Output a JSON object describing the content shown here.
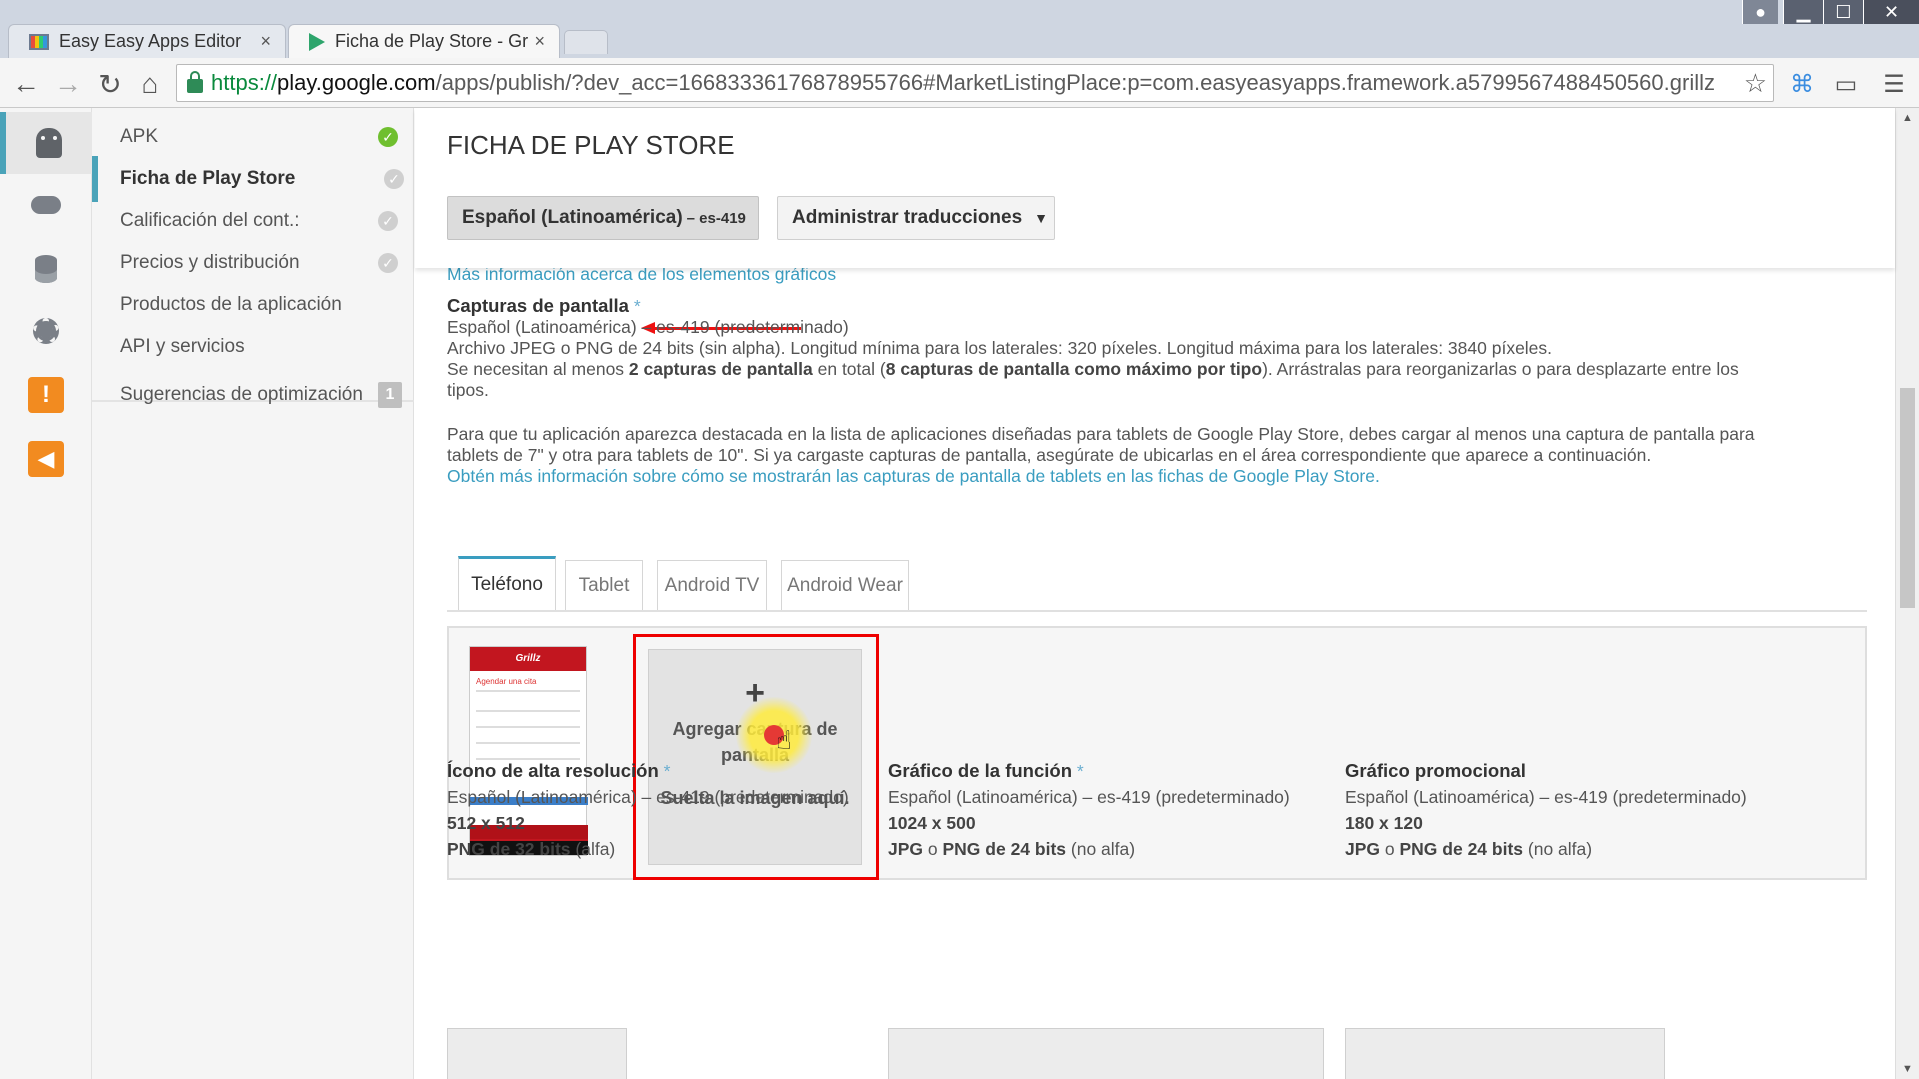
{
  "browser": {
    "tabs": [
      {
        "title": "Easy Easy Apps Editor",
        "icon": "editor-favicon",
        "active": false
      },
      {
        "title": "Ficha de Play Store - Grillz",
        "icon": "play-store-favicon",
        "active": true
      }
    ],
    "close_glyph": "×",
    "url": {
      "protocol": "https://",
      "host": "play.google.com",
      "path": "/apps/publish/?dev_acc=16683336176878955766#MarketListingPlace:p=com.easyeasyapps.framework.a5799567488450560.grillz"
    }
  },
  "rail": [
    "android-icon",
    "gamepad-icon",
    "database-icon",
    "gear-icon",
    "warning-icon",
    "megaphone-icon"
  ],
  "nav": {
    "items": [
      {
        "label": "APK",
        "status": "complete"
      },
      {
        "label": "Ficha de Play Store",
        "status": "pending",
        "active": true
      },
      {
        "label": "Calificación del cont.:",
        "status": "pending"
      },
      {
        "label": "Precios y distribución",
        "status": "pending"
      },
      {
        "label": "Productos de la aplicación"
      },
      {
        "label": "API y servicios"
      }
    ],
    "optimization": {
      "label": "Sugerencias de optimización",
      "count": "1"
    }
  },
  "header": {
    "title": "FICHA DE PLAY STORE",
    "language_button": "Español (Latinoamérica)",
    "language_code": "– es-419",
    "translations_button": "Administrar traducciones",
    "caret": "▼"
  },
  "graphics": {
    "more_info_link": "Más información acerca de los elementos gráficos"
  },
  "screenshots": {
    "title": "Capturas de pantalla",
    "required_mark": "*",
    "language": "Español (Latinoamérica) – es-419 (predeterminado)",
    "format": "Archivo JPEG o PNG de 24 bits (sin alpha). Longitud mínima para los laterales: 320 píxeles. Longitud máxima para los laterales: 3840 píxeles.",
    "need_prefix": "Se necesitan al menos ",
    "need_bold1": "2 capturas de pantalla",
    "need_mid": " en total (",
    "need_bold2": "8 capturas de pantalla como máximo por tipo",
    "need_suffix": "). Arrástralas para reorganizarlas o para desplazarte entre los",
    "need_cont": "tipos.",
    "tablet_info_1": "Para que tu aplicación aparezca destacada en la lista de aplicaciones diseñadas para tablets de Google Play Store, debes cargar al menos una captura de pantalla para",
    "tablet_info_2": "tablets de 7\" y otra para tablets de 10\". Si ya cargaste capturas de pantalla, asegúrate de ubicarlas en el área correspondiente que aparece a continuación.",
    "tablet_link": "Obtén más información sobre cómo se mostrarán las capturas de pantalla de tablets en las fichas de Google Play Store.",
    "tabs": [
      "Teléfono",
      "Tablet",
      "Android TV",
      "Android Wear"
    ],
    "phone_brand": "Grillz",
    "phone_heading": "Agendar una cita",
    "add_plus": "+",
    "add_label": "Agregar captura de pantalla",
    "drop_label": "Suelta la imagen aquí."
  },
  "assets": [
    {
      "title": "Ícono de alta resolución",
      "required": "*",
      "language": "Español (Latinoamérica) – es-419 (predeterminado)",
      "size": "512 x 512",
      "format_bold": "PNG de 32 bits",
      "format_rest": " (alfa)"
    },
    {
      "title": "Gráfico de la función",
      "required": "*",
      "language": "Español (Latinoamérica) – es-419 (predeterminado)",
      "size": "1024 x 500",
      "format_bold_1": "JPG",
      "format_mid": " o ",
      "format_bold": "PNG de 24 bits",
      "format_rest": " (no alfa)"
    },
    {
      "title": "Gráfico promocional",
      "required": "",
      "language": "Español (Latinoamérica) – es-419 (predeterminado)",
      "size": "180 x 120",
      "format_bold_1": "JPG",
      "format_mid": " o ",
      "format_bold": "PNG de 24 bits",
      "format_rest": " (no alfa)"
    }
  ],
  "colors": {
    "accent": "#3a9dc0",
    "highlight": "#e00000",
    "warning": "#f28b20",
    "success": "#6fbf2f"
  }
}
